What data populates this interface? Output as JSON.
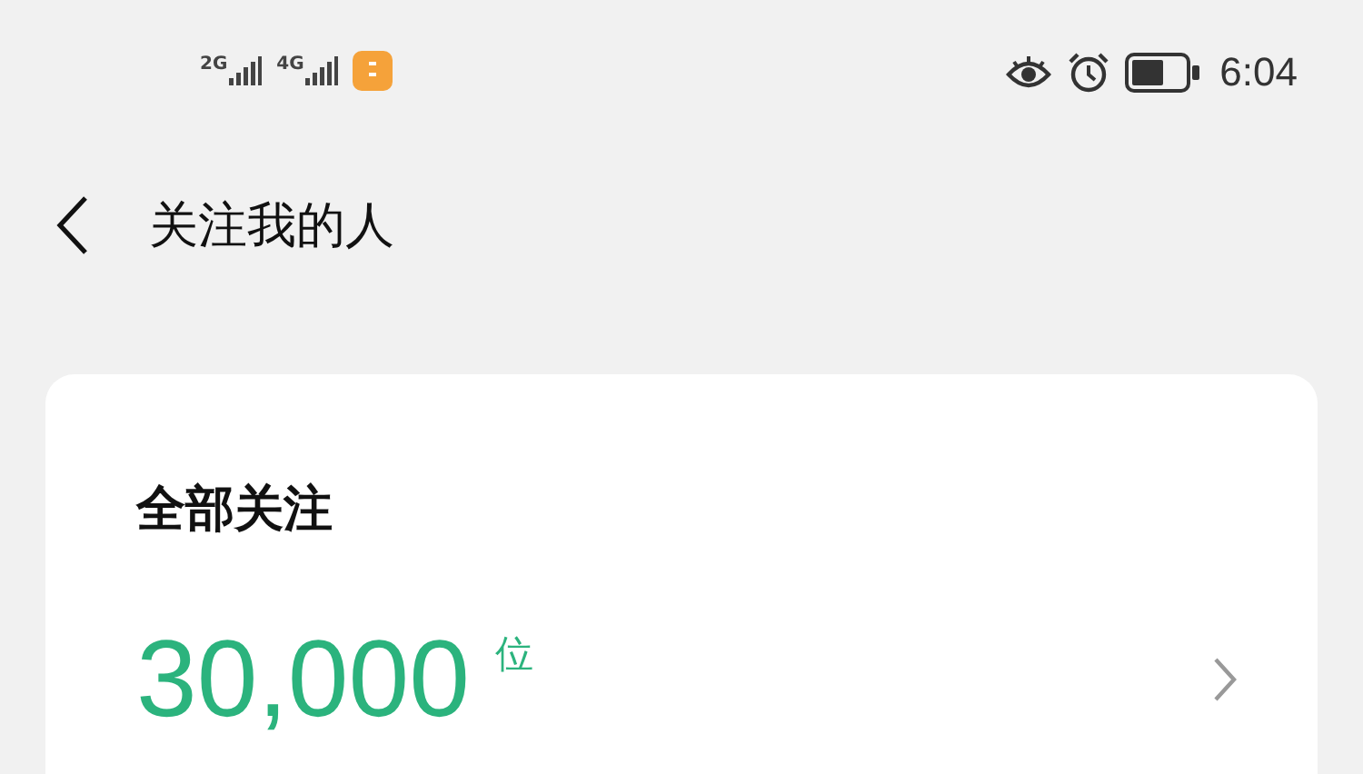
{
  "status_bar": {
    "signals": [
      {
        "network": "2G"
      },
      {
        "network": "4G"
      }
    ],
    "time": "6:04"
  },
  "header": {
    "title": "关注我的人"
  },
  "card": {
    "title": "全部关注",
    "count": "30,000",
    "unit": "位"
  }
}
